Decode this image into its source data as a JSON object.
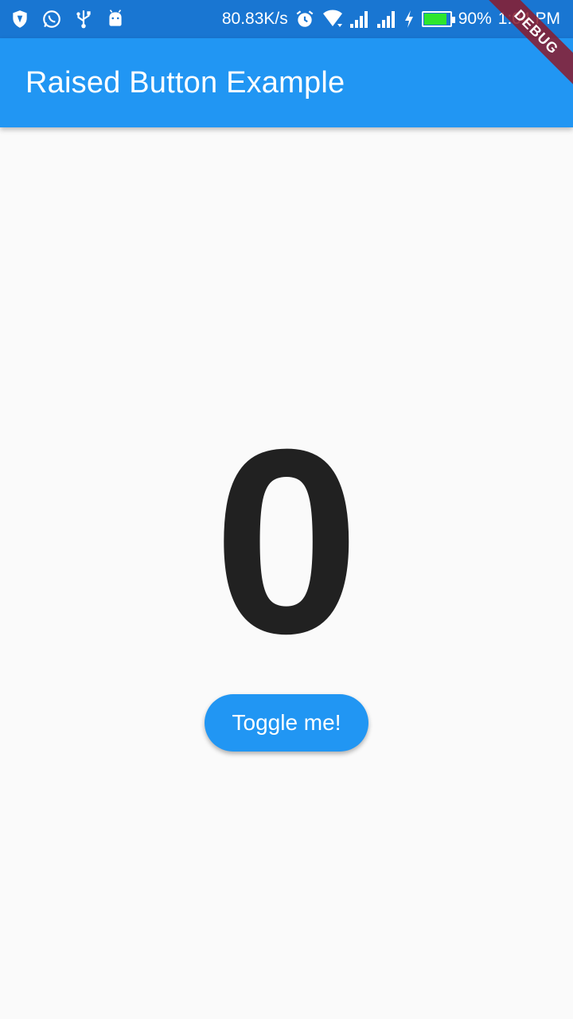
{
  "status_bar": {
    "left_icons": [
      "shield-icon",
      "whatsapp-icon",
      "usb-icon",
      "android-icon"
    ],
    "network_speed": "80.83K/s",
    "right_icons": [
      "alarm-icon",
      "wifi-icon",
      "signal-icon",
      "signal-icon",
      "charging-icon"
    ],
    "battery_level": 0.9,
    "battery_percent": "90%",
    "time": "1:04 PM"
  },
  "app_bar": {
    "title": "Raised Button Example"
  },
  "main": {
    "counter": "0",
    "button_label": "Toggle me!"
  },
  "debug_banner": "DEBUG",
  "colors": {
    "status_bar": "#1976d2",
    "app_bar": "#2196f3",
    "button": "#2196f3",
    "counter_text": "#212121",
    "background": "#fafafa",
    "battery_fill": "#2ee62e"
  }
}
